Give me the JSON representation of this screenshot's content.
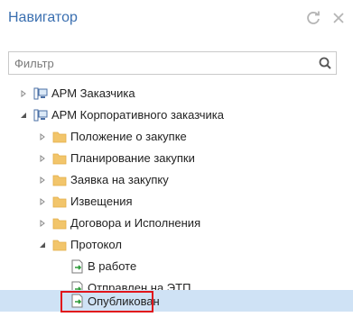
{
  "header": {
    "title": "Навигатор",
    "refresh_icon": "refresh-icon",
    "close_icon": "close-icon"
  },
  "filter": {
    "placeholder": "Фильтр",
    "value": ""
  },
  "tree": {
    "items": [
      {
        "label": "АРМ Заказчика",
        "icon": "workstation-icon",
        "state": "collapsed"
      },
      {
        "label": "АРМ Корпоративного заказчика",
        "icon": "workstation-icon",
        "state": "expanded"
      },
      {
        "label": "Положение о закупке",
        "icon": "folder-icon",
        "state": "collapsed"
      },
      {
        "label": "Планирование закупки",
        "icon": "folder-icon",
        "state": "collapsed"
      },
      {
        "label": "Заявка на закупку",
        "icon": "folder-icon",
        "state": "collapsed"
      },
      {
        "label": "Извещения",
        "icon": "folder-icon",
        "state": "collapsed"
      },
      {
        "label": "Договора и Исполнения",
        "icon": "folder-icon",
        "state": "collapsed"
      },
      {
        "label": "Протокол",
        "icon": "folder-icon",
        "state": "expanded"
      },
      {
        "label": "В работе",
        "icon": "document-arrow-icon",
        "state": "leaf"
      },
      {
        "label": "Отправлен на ЭТП",
        "icon": "document-arrow-icon",
        "state": "leaf"
      },
      {
        "label": "Опубликован",
        "icon": "document-arrow-icon",
        "state": "leaf",
        "selected": true
      }
    ]
  },
  "colors": {
    "title": "#3a6fb0",
    "folder": "#f2c56b",
    "selection": "#cfe2f5",
    "highlight_border": "#e1141b"
  }
}
